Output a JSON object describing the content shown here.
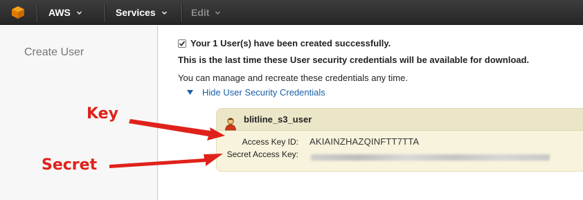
{
  "topbar": {
    "aws_label": "AWS",
    "services_label": "Services",
    "edit_label": "Edit"
  },
  "sidebar": {
    "title": "Create User"
  },
  "main": {
    "success_message": "Your 1 User(s) have been created successfully.",
    "warning_message": "This is the last time these User security credentials will be available for download.",
    "manage_message": "You can manage and recreate these credentials any time.",
    "toggle_link": "Hide User Security Credentials"
  },
  "credentials": {
    "user_name": "blitline_s3_user",
    "access_key_label": "Access Key ID:",
    "access_key_value": "AKIAINZHAZQINFTT7TTA",
    "secret_key_label": "Secret Access Key:"
  },
  "annotations": {
    "key_label": "Key",
    "secret_label": "Secret"
  },
  "colors": {
    "annotation_red": "#e0211b",
    "link_blue": "#1a5fa8",
    "aws_orange": "#f29100",
    "panel_bg": "#f7f3dc"
  }
}
